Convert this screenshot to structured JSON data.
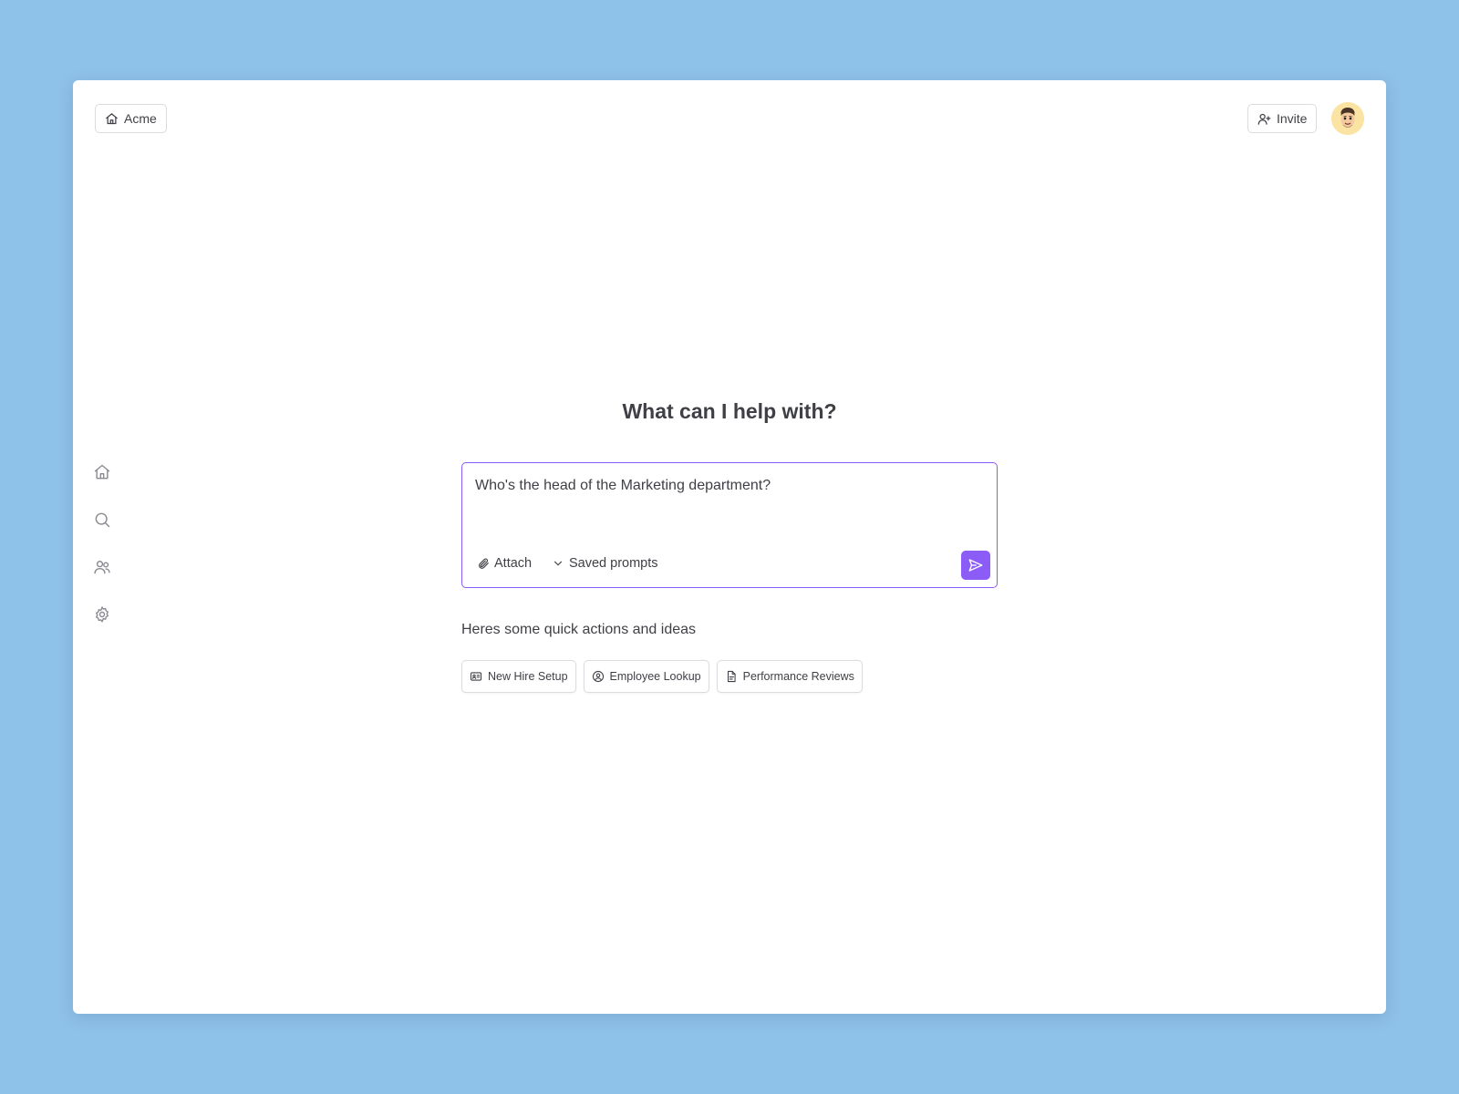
{
  "header": {
    "workspace": {
      "label": "Acme",
      "icon": "home-icon"
    },
    "invite": {
      "label": "Invite",
      "icon": "user-plus-icon"
    },
    "avatar": {
      "icon": "avatar-emoji"
    }
  },
  "sidebar": {
    "items": [
      {
        "name": "home",
        "icon": "home-icon"
      },
      {
        "name": "search",
        "icon": "search-icon"
      },
      {
        "name": "people",
        "icon": "users-icon"
      },
      {
        "name": "settings",
        "icon": "gear-icon"
      }
    ]
  },
  "main": {
    "title": "What can I help with?",
    "composer": {
      "value": "Who's the head of the Marketing department?",
      "attach_label": "Attach",
      "saved_prompts_label": "Saved prompts"
    },
    "ideas_title": "Heres some quick actions and ideas",
    "ideas": [
      {
        "label": "New Hire Setup",
        "icon": "id-card-icon"
      },
      {
        "label": "Employee Lookup",
        "icon": "user-circle-icon"
      },
      {
        "label": "Performance Reviews",
        "icon": "document-icon"
      }
    ]
  },
  "colors": {
    "background": "#8fc2e8",
    "accent": "#8b5cf6",
    "text": "#3f3f46",
    "border": "#dcdce0"
  }
}
